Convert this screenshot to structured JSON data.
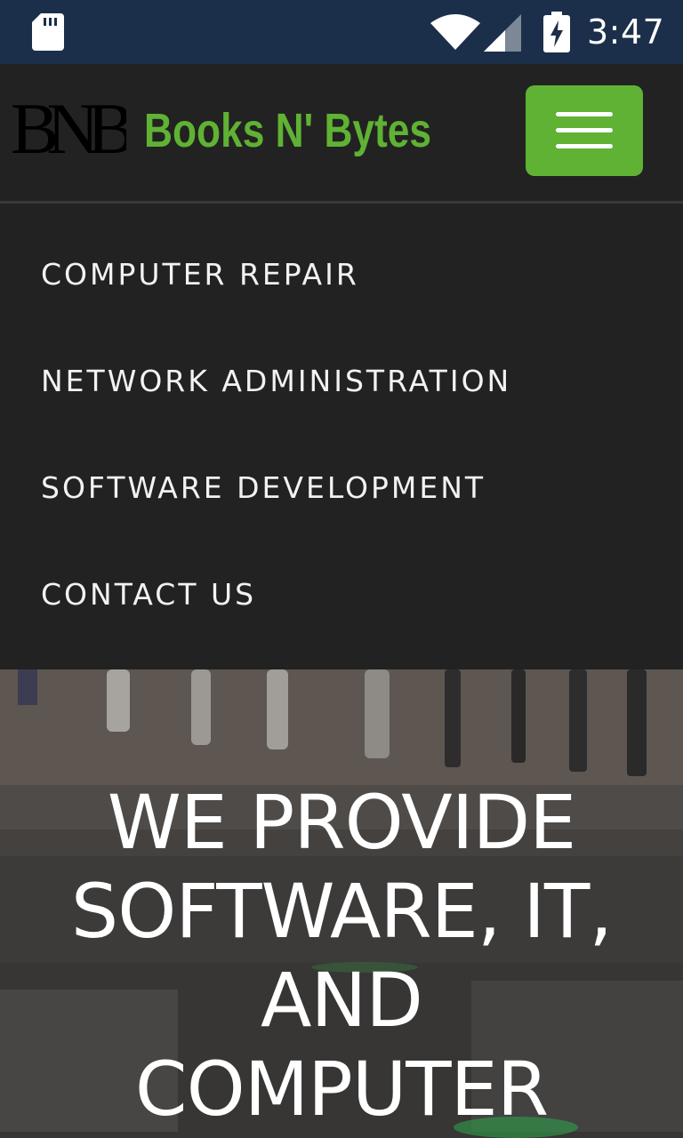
{
  "status_bar": {
    "time": "3:47",
    "icons": [
      "sd-card-icon",
      "wifi-icon",
      "cellular-signal-icon",
      "battery-charging-icon"
    ]
  },
  "header": {
    "logo_text": "BNB",
    "brand": "Books N' Bytes",
    "menu_toggle_icon": "hamburger-menu-icon"
  },
  "nav_menu": {
    "items": [
      {
        "label": "COMPUTER REPAIR"
      },
      {
        "label": "NETWORK ADMINISTRATION"
      },
      {
        "label": "SOFTWARE DEVELOPMENT"
      },
      {
        "label": "CONTACT US"
      }
    ]
  },
  "hero": {
    "title_lines": [
      "WE PROVIDE",
      "SOFTWARE, IT,",
      "AND",
      "COMPUTER"
    ]
  },
  "colors": {
    "accent": "#5fb233",
    "status_bar": "#1b2f4a",
    "navbar": "#222222"
  }
}
